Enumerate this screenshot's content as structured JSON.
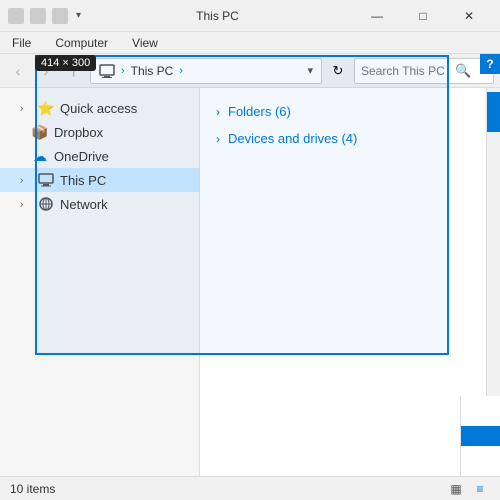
{
  "window": {
    "title": "This PC",
    "dimensions_label": "414 × 300"
  },
  "titlebar": {
    "title": "This PC",
    "controls": {
      "minimize": "—",
      "maximize": "□",
      "close": "✕"
    }
  },
  "menubar": {
    "items": [
      "File",
      "Computer",
      "View"
    ]
  },
  "addressbar": {
    "back_label": "‹",
    "forward_label": "›",
    "up_label": "↑",
    "address": "This PC",
    "refresh_label": "↻",
    "search_placeholder": "Search This PC",
    "search_btn_label": "🔍"
  },
  "sidebar": {
    "items": [
      {
        "label": "Quick access",
        "expanded": false,
        "indent": 0,
        "icon": "⭐",
        "icon_type": "star"
      },
      {
        "label": "Dropbox",
        "expanded": false,
        "indent": 1,
        "icon": "📦",
        "icon_type": "dropbox"
      },
      {
        "label": "OneDrive",
        "expanded": false,
        "indent": 1,
        "icon": "☁",
        "icon_type": "onedrive"
      },
      {
        "label": "This PC",
        "expanded": false,
        "indent": 0,
        "icon": "💻",
        "icon_type": "computer",
        "active": true
      },
      {
        "label": "Network",
        "expanded": false,
        "indent": 0,
        "icon": "🌐",
        "icon_type": "network"
      }
    ]
  },
  "main": {
    "sections": [
      {
        "title": "Folders (6)",
        "chevron": "›"
      },
      {
        "title": "Devices and drives (4)",
        "chevron": "›"
      }
    ]
  },
  "statusbar": {
    "items_count": "10 items",
    "view_icons": [
      "▦",
      "≡"
    ]
  },
  "help_btn": "?",
  "colors": {
    "accent": "#0078d7",
    "selection_border": "#0078d7"
  }
}
